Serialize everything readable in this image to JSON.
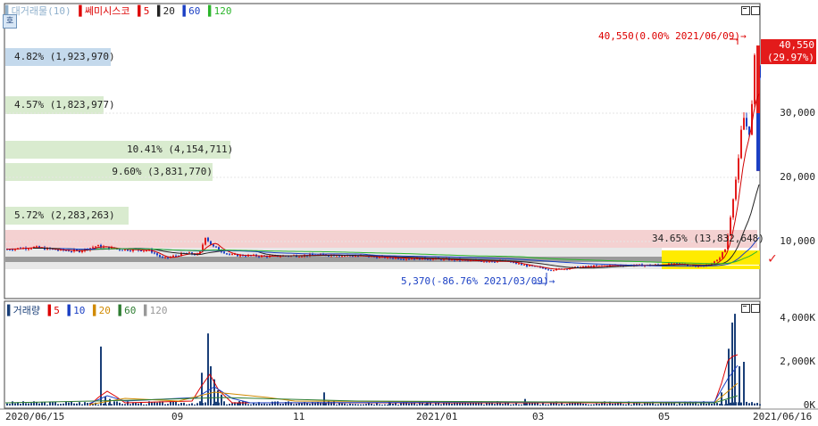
{
  "price_legend": {
    "profile": "▌대거래물(10)",
    "stock": "▌쎄미시스코",
    "ma5": "▌5",
    "ma20": "▌20",
    "ma60": "▌60",
    "ma120": "▌120",
    "settings_glyph": "호"
  },
  "volume_legend": {
    "title": "▌거래량",
    "ma5": "▌5",
    "ma10": "▌10",
    "ma20": "▌20",
    "ma60": "▌60",
    "ma120": "▌120"
  },
  "current": {
    "price": "40,550",
    "change": "(29.97%)"
  },
  "annotations": {
    "high": "40,550(0.00% 2021/06/09)→",
    "low": "5,370(-86.76% 2021/03/09)→",
    "check": "✓"
  },
  "colors": {
    "up": "#e31b1b",
    "down": "#1a3fc4",
    "ma5": "#d00000",
    "ma20": "#222222",
    "ma60": "#1a3fc4",
    "ma120": "#2bb52b"
  },
  "chart_data": [
    {
      "type": "candlestick",
      "title": "쎄미시스코",
      "y_ticks": [
        10000,
        20000,
        30000,
        40550
      ],
      "y_tick_labels": [
        "10,000",
        "20,000",
        "30,000",
        "40,550"
      ],
      "ylim": [
        4000,
        42000
      ],
      "x_ticks": [
        "2020/06/15",
        "09",
        "11",
        "2021/01",
        "03",
        "05",
        "2021/06/16"
      ],
      "close_path": [
        [
          0,
          8800
        ],
        [
          30,
          9100
        ],
        [
          55,
          8700
        ],
        [
          80,
          8500
        ],
        [
          100,
          9300
        ],
        [
          125,
          8800
        ],
        [
          160,
          8600
        ],
        [
          175,
          7300
        ],
        [
          200,
          8200
        ],
        [
          215,
          7900
        ],
        [
          222,
          10800
        ],
        [
          230,
          9200
        ],
        [
          250,
          7900
        ],
        [
          290,
          7700
        ],
        [
          320,
          7800
        ],
        [
          360,
          7900
        ],
        [
          400,
          7700
        ],
        [
          440,
          7400
        ],
        [
          480,
          7300
        ],
        [
          520,
          7000
        ],
        [
          560,
          6900
        ],
        [
          580,
          6300
        ],
        [
          610,
          5600
        ],
        [
          640,
          6000
        ],
        [
          680,
          6300
        ],
        [
          720,
          6300
        ],
        [
          750,
          6500
        ],
        [
          780,
          6100
        ],
        [
          795,
          7000
        ],
        [
          805,
          9000
        ],
        [
          810,
          14000
        ],
        [
          815,
          19000
        ],
        [
          818,
          21000
        ],
        [
          822,
          27000
        ],
        [
          826,
          30000
        ],
        [
          830,
          26000
        ],
        [
          834,
          31000
        ],
        [
          838,
          40550
        ],
        [
          842,
          36000
        ],
        [
          846,
          34000
        ],
        [
          850,
          40550
        ]
      ],
      "volume_profile": [
        {
          "label": "4.82% (1,923,970)",
          "color": "#c4d9ec"
        },
        {
          "label": "4.57% (1,823,977)",
          "color": "#d9ebcf"
        },
        {
          "label": "10.41% (4,154,711)",
          "color": "#d9ebcf"
        },
        {
          "label": "9.60% (3,831,770)",
          "color": "#d9ebcf"
        },
        {
          "label": "5.72% (2,283,263)",
          "color": "#d9ebcf"
        },
        {
          "label": "34.65% (13,832,648)",
          "color": "#f2c9c9"
        }
      ]
    },
    {
      "type": "bar",
      "title": "거래량",
      "y_ticks": [
        0,
        2000,
        4000
      ],
      "y_tick_labels": [
        "0K",
        "2,000K",
        "4,000K"
      ],
      "ylim": [
        0,
        4400
      ],
      "spikes": [
        [
          12,
          150
        ],
        [
          105,
          2700
        ],
        [
          110,
          400
        ],
        [
          115,
          300
        ],
        [
          218,
          1500
        ],
        [
          225,
          3300
        ],
        [
          228,
          1800
        ],
        [
          232,
          1200
        ],
        [
          236,
          700
        ],
        [
          240,
          500
        ],
        [
          260,
          200
        ],
        [
          355,
          600
        ],
        [
          428,
          180
        ],
        [
          470,
          200
        ],
        [
          580,
          300
        ],
        [
          705,
          150
        ],
        [
          800,
          600
        ],
        [
          805,
          250
        ],
        [
          808,
          2600
        ],
        [
          812,
          3800
        ],
        [
          815,
          4200
        ],
        [
          820,
          1800
        ],
        [
          825,
          2000
        ]
      ]
    }
  ]
}
